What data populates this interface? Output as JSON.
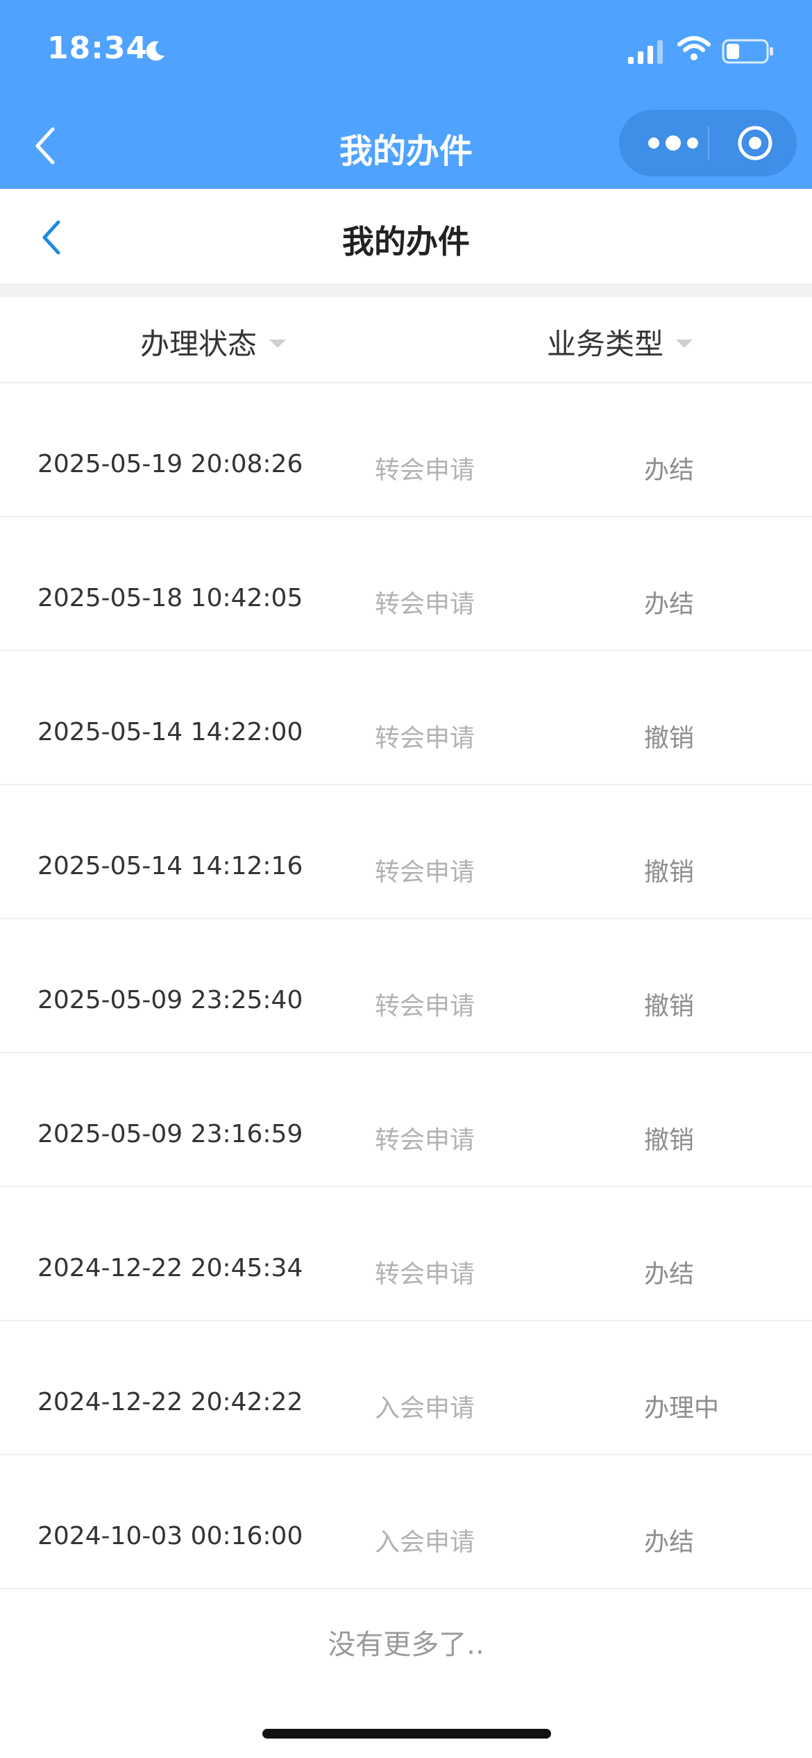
{
  "status_bar": {
    "time": "18:34"
  },
  "nav": {
    "title": "我的办件"
  },
  "sub_header": {
    "title": "我的办件"
  },
  "filters": [
    {
      "label": "办理状态"
    },
    {
      "label": "业务类型"
    }
  ],
  "items": [
    {
      "date": "2025-05-19 20:08:26",
      "type": "转会申请",
      "status": "办结"
    },
    {
      "date": "2025-05-18 10:42:05",
      "type": "转会申请",
      "status": "办结"
    },
    {
      "date": "2025-05-14 14:22:00",
      "type": "转会申请",
      "status": "撤销"
    },
    {
      "date": "2025-05-14 14:12:16",
      "type": "转会申请",
      "status": "撤销"
    },
    {
      "date": "2025-05-09 23:25:40",
      "type": "转会申请",
      "status": "撤销"
    },
    {
      "date": "2025-05-09 23:16:59",
      "type": "转会申请",
      "status": "撤销"
    },
    {
      "date": "2024-12-22 20:45:34",
      "type": "转会申请",
      "status": "办结"
    },
    {
      "date": "2024-12-22 20:42:22",
      "type": "入会申请",
      "status": "办理中"
    },
    {
      "date": "2024-10-03 00:16:00",
      "type": "入会申请",
      "status": "办结"
    }
  ],
  "footer": {
    "text": "没有更多了.."
  },
  "colors": {
    "header_blue": "#4fa3ff",
    "accent_blue": "#1e88e5"
  }
}
